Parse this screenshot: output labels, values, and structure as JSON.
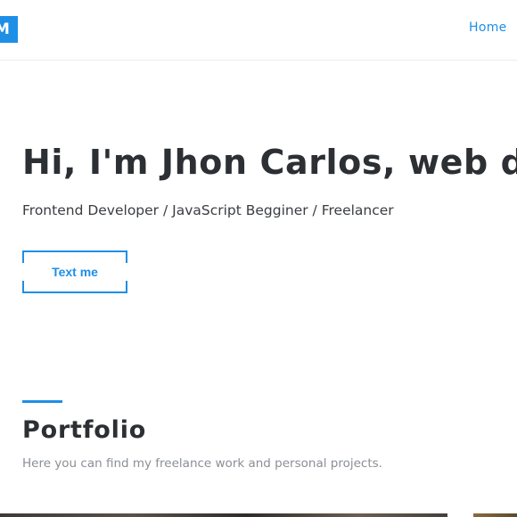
{
  "header": {
    "logo_letter": "M",
    "nav": {
      "home_label": "Home"
    }
  },
  "hero": {
    "title": "Hi, I'm Jhon Carlos, web developer",
    "subtitle": "Frontend Developer / JavaScript Begginer / Freelancer",
    "cta_label": "Text me"
  },
  "portfolio": {
    "title": "Portfolio",
    "subtitle": "Here you can find my freelance work and personal projects."
  },
  "colors": {
    "accent": "#1e8fe6",
    "heading": "#2c2f33",
    "muted": "#8a8f96"
  }
}
